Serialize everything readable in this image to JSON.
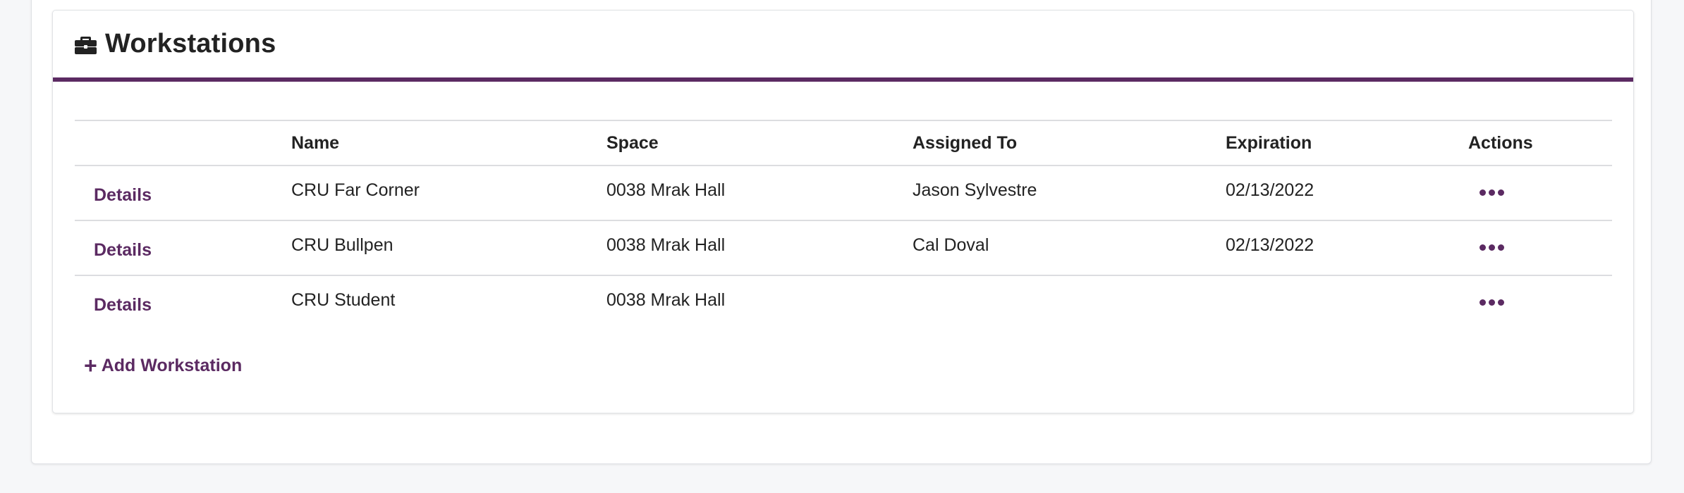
{
  "panel": {
    "title": "Workstations",
    "icon": "briefcase-icon"
  },
  "table": {
    "headers": [
      "",
      "Name",
      "Space",
      "Assigned To",
      "Expiration",
      "Actions"
    ],
    "rows": [
      {
        "details": "Details",
        "name": "CRU Far Corner",
        "space": "0038 Mrak Hall",
        "assigned_to": "Jason Sylvestre",
        "expiration": "02/13/2022",
        "actions_icon": "more-icon"
      },
      {
        "details": "Details",
        "name": "CRU Bullpen",
        "space": "0038 Mrak Hall",
        "assigned_to": "Cal Doval",
        "expiration": "02/13/2022",
        "actions_icon": "more-icon"
      },
      {
        "details": "Details",
        "name": "CRU Student",
        "space": "0038 Mrak Hall",
        "assigned_to": "",
        "expiration": "",
        "actions_icon": "more-icon"
      }
    ]
  },
  "add_button": {
    "plus": "+",
    "label": "Add Workstation"
  },
  "colors": {
    "accent": "#5b2a62",
    "text": "#222222",
    "border": "#dcdde0",
    "background": "#f6f7f9"
  }
}
